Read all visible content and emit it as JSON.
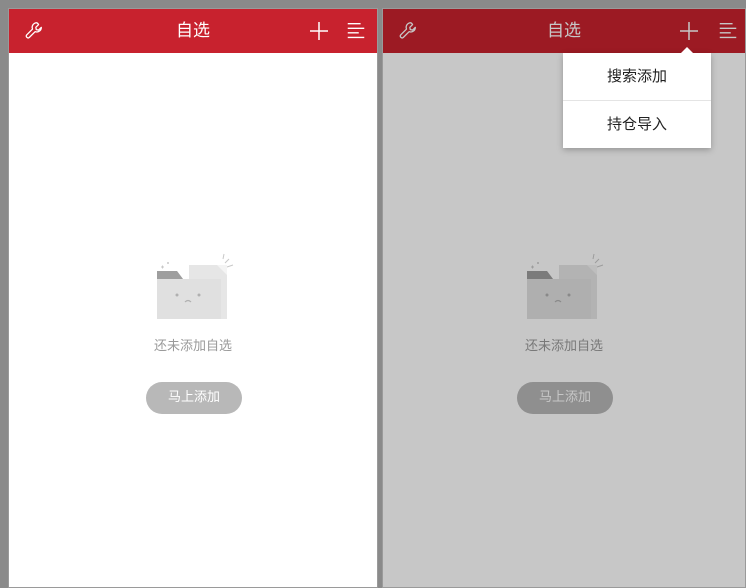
{
  "colors": {
    "header_bg": "#c8222e",
    "button_bg": "#b8b8b8",
    "empty_text": "#9a9a9a"
  },
  "left_screen": {
    "header": {
      "title": "自选",
      "left_icon": "wrench-icon",
      "right_icons": [
        "plus-icon",
        "menu-icon"
      ]
    },
    "empty_state": {
      "illustration": "empty-folder-icon",
      "text": "还未添加自选",
      "button_label": "马上添加"
    }
  },
  "right_screen": {
    "header": {
      "title": "自选",
      "left_icon": "wrench-icon",
      "right_icons": [
        "plus-icon",
        "menu-icon"
      ]
    },
    "empty_state": {
      "illustration": "empty-folder-icon",
      "text": "还未添加自选",
      "button_label": "马上添加"
    },
    "dropdown": {
      "items": [
        {
          "label": "搜索添加"
        },
        {
          "label": "持仓导入"
        }
      ]
    }
  }
}
